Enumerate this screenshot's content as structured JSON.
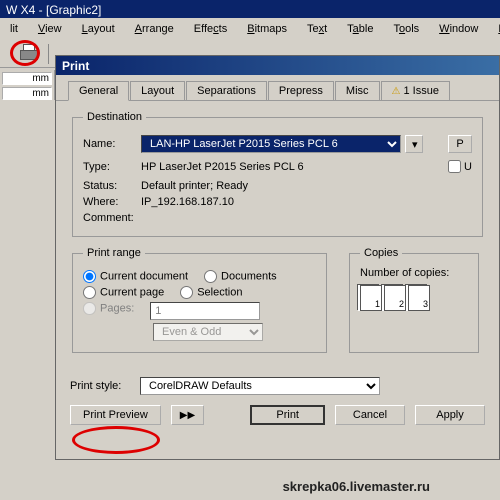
{
  "app": {
    "title": "W X4 - [Graphic2]"
  },
  "menu": {
    "edit": "lit",
    "view": "View",
    "layout": "Layout",
    "arrange": "Arrange",
    "effects": "Effects",
    "bitmaps": "Bitmaps",
    "text": "Text",
    "table": "Table",
    "tools": "Tools",
    "window": "Window",
    "help": "Help"
  },
  "left": {
    "unit1": "mm",
    "unit2": "mm"
  },
  "dialog": {
    "title": "Print",
    "tabs": {
      "general": "General",
      "layout": "Layout",
      "separations": "Separations",
      "prepress": "Prepress",
      "misc": "Misc",
      "issue": "1 Issue"
    },
    "dest": {
      "legend": "Destination",
      "name_lbl": "Name:",
      "name_val": "LAN-HP LaserJet P2015 Series PCL 6",
      "type_lbl": "Type:",
      "type_val": "HP LaserJet P2015 Series PCL 6",
      "status_lbl": "Status:",
      "status_val": "Default printer; Ready",
      "where_lbl": "Where:",
      "where_val": "IP_192.168.187.10",
      "comment_lbl": "Comment:",
      "p_btn": "P",
      "u_chk": "U"
    },
    "range": {
      "legend": "Print range",
      "curdoc": "Current document",
      "docs": "Documents",
      "curpage": "Current page",
      "sel": "Selection",
      "pages": "Pages:",
      "pages_val": "1",
      "eo": "Even & Odd"
    },
    "copies": {
      "legend": "Copies",
      "num": "Number of copies:",
      "p1": "1",
      "p2": "2",
      "p3": "3"
    },
    "style": {
      "lbl": "Print style:",
      "val": "CorelDRAW Defaults"
    },
    "btns": {
      "preview": "Print Preview",
      "arrow": "▶|",
      "print": "Print",
      "cancel": "Cancel",
      "apply": "Apply"
    }
  },
  "footer": "skrepka06.livemaster.ru"
}
